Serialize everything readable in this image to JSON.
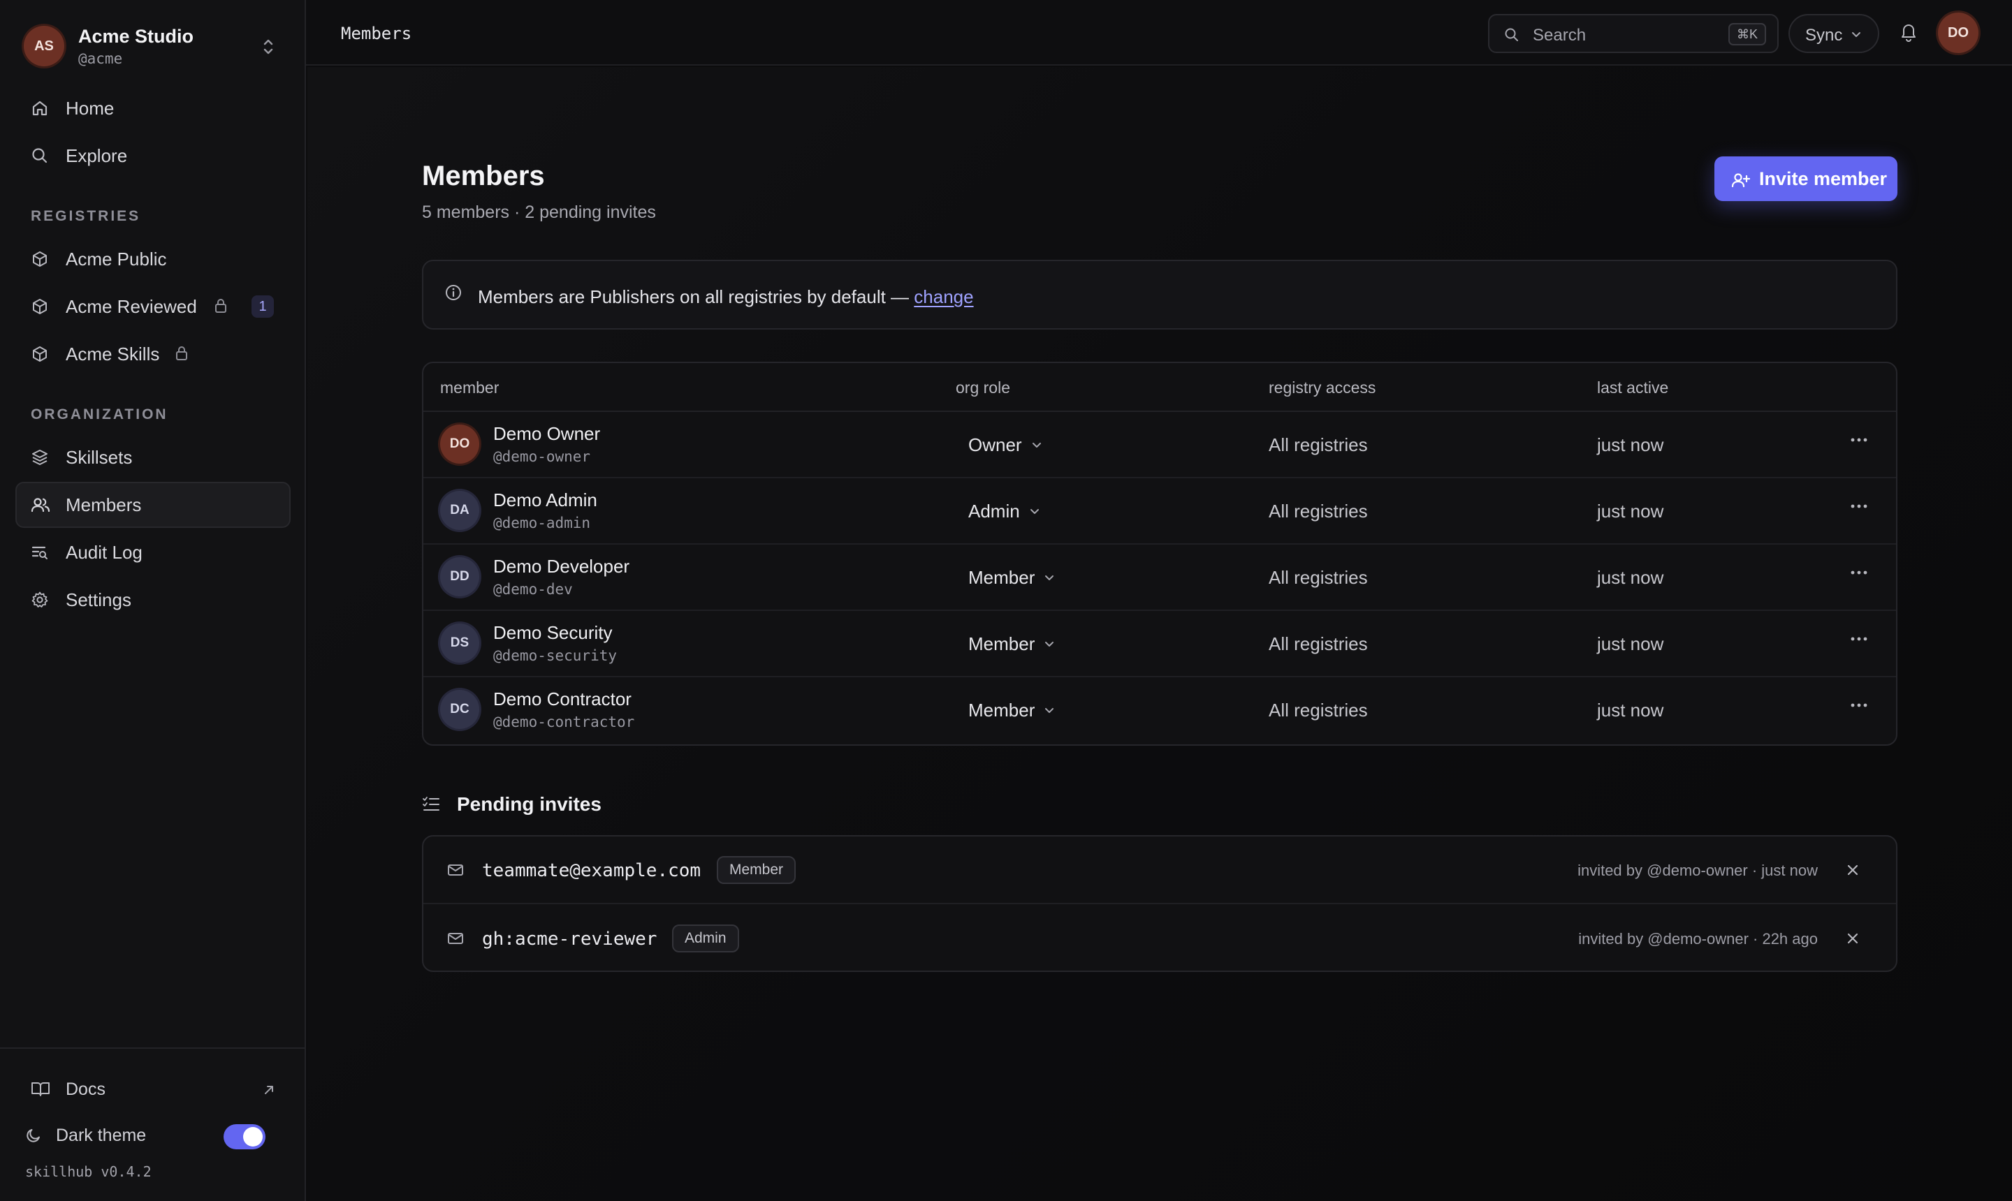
{
  "org": {
    "initials": "AS",
    "name": "Acme Studio",
    "handle": "@acme"
  },
  "nav": {
    "home": "Home",
    "explore": "Explore",
    "registries_label": "REGISTRIES",
    "registries": [
      {
        "label": "Acme Public"
      },
      {
        "label": "Acme Reviewed",
        "locked": true,
        "badge": "1"
      },
      {
        "label": "Acme Skills",
        "locked": true
      }
    ],
    "organization_label": "ORGANIZATION",
    "organization": [
      {
        "label": "Skillsets"
      },
      {
        "label": "Members",
        "active": true
      },
      {
        "label": "Audit Log"
      },
      {
        "label": "Settings"
      }
    ]
  },
  "footer": {
    "docs": "Docs",
    "theme_label": "Dark theme",
    "theme_on": true,
    "version": "skillhub v0.4.2"
  },
  "topbar": {
    "breadcrumb": "Members",
    "search_placeholder": "Search",
    "search_shortcut": "⌘K",
    "sync_label": "Sync",
    "user_initials": "DO"
  },
  "page": {
    "title": "Members",
    "subtitle": "5 members · 2 pending invites",
    "invite_button": "Invite member",
    "notice_text": "Members are Publishers on all registries by default — ",
    "notice_link": "change"
  },
  "table": {
    "headers": {
      "member": "member",
      "role": "org role",
      "access": "registry access",
      "last_active": "last active"
    },
    "rows": [
      {
        "initials": "DO",
        "name": "Demo Owner",
        "handle": "@demo-owner",
        "role": "Owner",
        "access": "All registries",
        "last_active": "just now"
      },
      {
        "initials": "DA",
        "name": "Demo Admin",
        "handle": "@demo-admin",
        "role": "Admin",
        "access": "All registries",
        "last_active": "just now"
      },
      {
        "initials": "DD",
        "name": "Demo Developer",
        "handle": "@demo-dev",
        "role": "Member",
        "access": "All registries",
        "last_active": "just now"
      },
      {
        "initials": "DS",
        "name": "Demo Security",
        "handle": "@demo-security",
        "role": "Member",
        "access": "All registries",
        "last_active": "just now"
      },
      {
        "initials": "DC",
        "name": "Demo Contractor",
        "handle": "@demo-contractor",
        "role": "Member",
        "access": "All registries",
        "last_active": "just now"
      }
    ]
  },
  "pending": {
    "title": "Pending invites",
    "invites": [
      {
        "email": "teammate@example.com",
        "role": "Member",
        "meta": "invited by @demo-owner · just now"
      },
      {
        "email": "gh:acme-reviewer",
        "role": "Admin",
        "meta": "invited by @demo-owner · 22h ago"
      }
    ]
  },
  "colors": {
    "accent": "#6366f1",
    "owner_avatar": "#6c3024",
    "member_avatar": "#32344a",
    "link": "#9fa2ff"
  }
}
